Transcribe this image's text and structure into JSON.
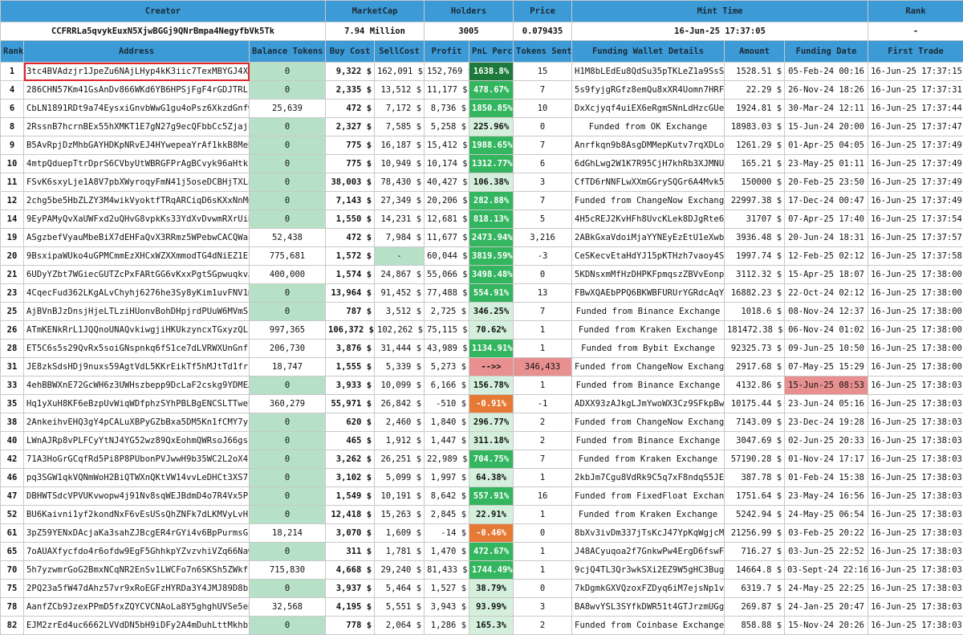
{
  "top_header": {
    "labels": [
      "Creator",
      "MarketCap",
      "Holders",
      "Price",
      "Mint Time",
      "Rank"
    ],
    "values": [
      "CCFRRLa5qvykEuxN5XjwBGGj9QNrBmpa4NegyfbVk5Tk",
      "7.94 Million",
      "3005",
      "0.079435",
      "16-Jun-25 17:37:05",
      "-"
    ]
  },
  "columns": [
    "Rank",
    "Address",
    "Balance Tokens",
    "Buy Cost",
    "SellCost",
    "Profit",
    "PnL Perc",
    "Tokens Sent",
    "Funding Wallet Details",
    "Amount",
    "Funding Date",
    "First Trade"
  ],
  "colors": {
    "header": "#3c9bd6",
    "balance_zero": "#b7e1c7",
    "pnl_dark": "#1e7a3c",
    "pnl_green": "#34b55f",
    "pnl_light": "#d4f0dc",
    "pnl_orange": "#e67a35",
    "alert_red": "#e89090",
    "highlight": "#e0252b"
  },
  "rows": [
    {
      "rank": "1",
      "address": "3tc4BVAdzjr1JpeZu6NAjLHyp4kK3iic7TexMBYGJ4Xk",
      "balance": "0",
      "buy": "9,322 $",
      "sell": "162,091 $",
      "profit": "152,769 $",
      "pnl": "1638.8%",
      "pnl_style": "dark",
      "sent": "15",
      "funding": "H1M8bLEdEu8QdSu35pTKLeZ1a9SsSn",
      "amount": "1528.51 $",
      "fdate": "05-Feb-24 00:16",
      "first": "16-Jun-25 17:37:15"
    },
    {
      "rank": "4",
      "address": "286CHN57Km41GsAnDv866WKd6YB6HPSjFgF4rGDJTRLf",
      "balance": "0",
      "buy": "2,335 $",
      "sell": "13,512 $",
      "profit": "11,177 $",
      "pnl": "478.67%",
      "pnl_style": "green",
      "sent": "7",
      "funding": "5s9fyjgRGfz8emQu8xXR4Uomn7HRFH",
      "amount": "22.29 $",
      "fdate": "26-Nov-24 18:26",
      "first": "16-Jun-25 17:37:31"
    },
    {
      "rank": "6",
      "address": "CbLN1891RDt9a74EysxiGnvbWwG1gu4oPsz6XkzdGnfw",
      "balance": "25,639",
      "buy": "472 $",
      "sell": "7,172 $",
      "profit": "8,736 $",
      "pnl": "1850.85%",
      "pnl_style": "green",
      "sent": "10",
      "funding": "DxXcjyqf4uiEX6eRgmSNnLdHzcGUeC",
      "amount": "1924.81 $",
      "fdate": "30-Mar-24 12:11",
      "first": "16-Jun-25 17:37:44"
    },
    {
      "rank": "8",
      "address": "2RssnB7hcrnBEx55hXMKT1E7gN27g9ecQFbbCc5Zjajq",
      "balance": "0",
      "buy": "2,327 $",
      "sell": "7,585 $",
      "profit": "5,258 $",
      "pnl": "225.96%",
      "pnl_style": "light",
      "sent": "0",
      "funding": "Funded from OK Exchange",
      "amount": "18983.03 $",
      "fdate": "15-Jun-24 20:00",
      "first": "16-Jun-25 17:37:47"
    },
    {
      "rank": "9",
      "address": "B5AvRpjDzMhbGAYHDKpNRvEJ4HYwepeaYrAf1kkB8MeR",
      "balance": "0",
      "buy": "775 $",
      "sell": "16,187 $",
      "profit": "15,412 $",
      "pnl": "1988.65%",
      "pnl_style": "green",
      "sent": "7",
      "funding": "Anrfkqn9b8AsgDMMepKutv7rqXDLoy",
      "amount": "1261.29 $",
      "fdate": "01-Apr-25 04:05",
      "first": "16-Jun-25 17:37:49"
    },
    {
      "rank": "10",
      "address": "4mtpQduepTtrDprS6CVbyUtWBRGFPrAgBCvyk96aHtkb",
      "balance": "0",
      "buy": "775 $",
      "sell": "10,949 $",
      "profit": "10,174 $",
      "pnl": "1312.77%",
      "pnl_style": "green",
      "sent": "6",
      "funding": "6dGhLwg2W1K7R95CjH7khRb3XJMNU6",
      "amount": "165.21 $",
      "fdate": "23-May-25 01:11",
      "first": "16-Jun-25 17:37:49"
    },
    {
      "rank": "11",
      "address": "FSvK6sxyLje1A8V7pbXWyroqyFmN41j5oseDCBHjTXL4",
      "balance": "0",
      "buy": "38,003 $",
      "sell": "78,430 $",
      "profit": "40,427 $",
      "pnl": "106.38%",
      "pnl_style": "light",
      "sent": "3",
      "funding": "CfTD6rNNFLwXXmGGrySQGr6A4Mvk5z",
      "amount": "150000 $",
      "fdate": "20-Feb-25 23:50",
      "first": "16-Jun-25 17:37:49"
    },
    {
      "rank": "12",
      "address": "2chg5be5HbZLZY3M4wikVyoktfTRqARCiqD6sKXxNnMm",
      "balance": "0",
      "buy": "7,143 $",
      "sell": "27,349 $",
      "profit": "20,206 $",
      "pnl": "282.88%",
      "pnl_style": "green",
      "sent": "7",
      "funding": "Funded from ChangeNow Exchange",
      "amount": "22997.38 $",
      "fdate": "17-Dec-24 00:47",
      "first": "16-Jun-25 17:37:49"
    },
    {
      "rank": "14",
      "address": "9EyPAMyQvXaUWFxd2uQHvG8vpkKs33YdXvDvwmRXrUiH",
      "balance": "0",
      "buy": "1,550 $",
      "sell": "14,231 $",
      "profit": "12,681 $",
      "pnl": "818.13%",
      "pnl_style": "green",
      "sent": "5",
      "funding": "4H5cREJ2KvHFh8UvcKLek8DJgRte6k",
      "amount": "31707 $",
      "fdate": "07-Apr-25 17:40",
      "first": "16-Jun-25 17:37:54"
    },
    {
      "rank": "19",
      "address": "ASgzbefVyauMbeBiX7dEHFaQvX3RRmz5WPebwCACQWaq",
      "balance": "52,438",
      "buy": "472 $",
      "sell": "7,984 $",
      "profit": "11,677 $",
      "pnl": "2473.94%",
      "pnl_style": "green",
      "sent": "3,216",
      "funding": "2ABkGxaVdoiMjaYYNEyEzEtU1eXwbx",
      "amount": "3936.48 $",
      "fdate": "20-Jun-24 18:31",
      "first": "16-Jun-25 17:37:57"
    },
    {
      "rank": "20",
      "address": "9BsxipaWUko4uGPMCmmEzXHCxWZXXmmodTG4dNiEZ1Et",
      "balance": "775,681",
      "buy": "1,572 $",
      "sell": "-",
      "profit": "60,044 $",
      "pnl": "3819.59%",
      "pnl_style": "green",
      "sent": "-3",
      "funding": "CeSKecvEtaHdYJ15pKTHzh7vaoy4SY",
      "amount": "1997.74 $",
      "fdate": "12-Feb-25 02:12",
      "first": "16-Jun-25 17:37:58"
    },
    {
      "rank": "21",
      "address": "6UDyYZbt7WGiecGUTZcPxFARtGG6vKxxPgtSGpwuqkvA",
      "balance": "400,000",
      "buy": "1,574 $",
      "sell": "24,867 $",
      "profit": "55,066 $",
      "pnl": "3498.48%",
      "pnl_style": "green",
      "sent": "0",
      "funding": "5KDNsxmMfHzDHPKFpmqszZBVvEonp",
      "amount": "3112.32 $",
      "fdate": "15-Apr-25 18:07",
      "first": "16-Jun-25 17:38:00"
    },
    {
      "rank": "23",
      "address": "4CqecFud362LKgALvChyhj6276he3Sy8yKim1uvFNV1m",
      "balance": "0",
      "buy": "13,964 $",
      "sell": "91,452 $",
      "profit": "77,488 $",
      "pnl": "554.91%",
      "pnl_style": "green",
      "sent": "13",
      "funding": "FBwXQAEbPPQ6BKWBFURUrYGRdcAqYT",
      "amount": "16882.23 $",
      "fdate": "22-Oct-24 02:12",
      "first": "16-Jun-25 17:38:00"
    },
    {
      "rank": "25",
      "address": "AjBVnBJzDnsjHjeLTLziHUonvBohDHpjrdPUuW6MVmS2",
      "balance": "0",
      "buy": "787 $",
      "sell": "3,512 $",
      "profit": "2,725 $",
      "pnl": "346.25%",
      "pnl_style": "light",
      "sent": "7",
      "funding": "Funded from Binance Exchange",
      "amount": "1018.6 $",
      "fdate": "08-Nov-24 12:37",
      "first": "16-Jun-25 17:38:00"
    },
    {
      "rank": "26",
      "address": "ATmKENkRrL1JQQnoUNAQvkiwgjiHKUkzyncxTGxyzQL1",
      "balance": "997,365",
      "buy": "106,372 $",
      "sell": "102,262 $",
      "profit": "75,115 $",
      "pnl": "70.62%",
      "pnl_style": "light",
      "sent": "1",
      "funding": "Funded from Kraken Exchange",
      "amount": "181472.38 $",
      "fdate": "06-Nov-24 01:02",
      "first": "16-Jun-25 17:38:00"
    },
    {
      "rank": "28",
      "address": "ET5C6s5s29QvRx5soiGNspnkq6fS1ce7dLVRWXUnGnf",
      "balance": "206,730",
      "buy": "3,876 $",
      "sell": "31,444 $",
      "profit": "43,989 $",
      "pnl": "1134.91%",
      "pnl_style": "green",
      "sent": "1",
      "funding": "Funded from Bybit Exchange",
      "amount": "92325.73 $",
      "fdate": "09-Jun-25 10:50",
      "first": "16-Jun-25 17:38:00"
    },
    {
      "rank": "31",
      "address": "JE8zkSdsHDj9nuxs59AgtVdL5KKrEikTf5hMJtTd1frP",
      "balance": "18,747",
      "buy": "1,555 $",
      "sell": "5,339 $",
      "profit": "5,273 $",
      "pnl": "-->>",
      "pnl_style": "red",
      "sent": "346,433",
      "funding": "Funded from ChangeNow Exchange",
      "amount": "2917.68 $",
      "fdate": "07-May-25 15:29",
      "first": "16-Jun-25 17:38:00"
    },
    {
      "rank": "33",
      "address": "4ehBBWXnE72GcWH6z3UWHszbepp9DcLaF2cskg9YDMEA",
      "balance": "0",
      "buy": "3,933 $",
      "sell": "10,099 $",
      "profit": "6,166 $",
      "pnl": "156.78%",
      "pnl_style": "light",
      "sent": "1",
      "funding": "Funded from Binance Exchange",
      "amount": "4132.86 $",
      "fdate": "15-Jun-25 08:53",
      "first": "16-Jun-25 17:38:03"
    },
    {
      "rank": "35",
      "address": "Hq1yXuH8KF6eBzpUvWiqWDfphzSYhPBLBgENCSLTTweU",
      "balance": "360,279",
      "buy": "55,971 $",
      "sell": "26,842 $",
      "profit": "-510 $",
      "pnl": "-0.91%",
      "pnl_style": "orange",
      "sent": "-1",
      "funding": "ADXX93zAJkgLJmYwoWX3Cz9SFkpBwW",
      "amount": "10175.44 $",
      "fdate": "23-Jun-24 05:16",
      "first": "16-Jun-25 17:38:03"
    },
    {
      "rank": "38",
      "address": "2AnkeihvEHQ3gY4pCALuXBPyGZbBxa5DM5Kn1fCMY7yh",
      "balance": "0",
      "buy": "620 $",
      "sell": "2,460 $",
      "profit": "1,840 $",
      "pnl": "296.77%",
      "pnl_style": "light",
      "sent": "2",
      "funding": "Funded from ChangeNow Exchange",
      "amount": "7143.09 $",
      "fdate": "23-Dec-24 19:28",
      "first": "16-Jun-25 17:38:03"
    },
    {
      "rank": "40",
      "address": "LWnAJRp8vPLFCyYtNJ4YG52wz89QxEohmQWRsoJ66gs",
      "balance": "0",
      "buy": "465 $",
      "sell": "1,912 $",
      "profit": "1,447 $",
      "pnl": "311.18%",
      "pnl_style": "light",
      "sent": "2",
      "funding": "Funded from Binance Exchange",
      "amount": "3047.69 $",
      "fdate": "02-Jun-25 20:33",
      "first": "16-Jun-25 17:38:03"
    },
    {
      "rank": "42",
      "address": "71A3HoGrGCqfRd5Pi8P8PUbonPVJwwH9b35WC2L2oX4i",
      "balance": "0",
      "buy": "3,262 $",
      "sell": "26,251 $",
      "profit": "22,989 $",
      "pnl": "704.75%",
      "pnl_style": "green",
      "sent": "7",
      "funding": "Funded from Kraken Exchange",
      "amount": "57190.28 $",
      "fdate": "01-Nov-24 17:17",
      "first": "16-Jun-25 17:38:03"
    },
    {
      "rank": "46",
      "address": "pq3SGW1qkVQNmWoH2BiQTWXnQKtVW14vvLeDHCt3XS7",
      "balance": "0",
      "buy": "3,102 $",
      "sell": "5,099 $",
      "profit": "1,997 $",
      "pnl": "64.38%",
      "pnl_style": "light",
      "sent": "1",
      "funding": "2kbJm7Cgu8VdRk9C5q7xF8ndqS5JEy",
      "amount": "387.78 $",
      "fdate": "01-Feb-24 15:38",
      "first": "16-Jun-25 17:38:03"
    },
    {
      "rank": "47",
      "address": "DBHWTSdcVPVUKvwopw4j91Nv8sqWEJBdmD4o7R4Vx5Pi",
      "balance": "0",
      "buy": "1,549 $",
      "sell": "10,191 $",
      "profit": "8,642 $",
      "pnl": "557.91%",
      "pnl_style": "green",
      "sent": "16",
      "funding": "Funded from FixedFloat Exchang",
      "amount": "1751.64 $",
      "fdate": "23-May-24 16:56",
      "first": "16-Jun-25 17:38:03"
    },
    {
      "rank": "52",
      "address": "BU6Kaivni1yf2kondNxF6vEsUSsQhZNFk7dLKMVyLvHz",
      "balance": "0",
      "buy": "12,418 $",
      "sell": "15,263 $",
      "profit": "2,845 $",
      "pnl": "22.91%",
      "pnl_style": "light",
      "sent": "1",
      "funding": "Funded from Kraken Exchange",
      "amount": "5242.94 $",
      "fdate": "24-May-25 06:54",
      "first": "16-Jun-25 17:38:03"
    },
    {
      "rank": "61",
      "address": "3pZ59YENxDAcjaKa3sahZJBcgER4rGYi4v6BpPurmsGj",
      "balance": "18,214",
      "buy": "3,070 $",
      "sell": "1,609 $",
      "profit": "-14 $",
      "pnl": "-0.46%",
      "pnl_style": "orange",
      "sent": "0",
      "funding": "8bXv3ivDm337jTsKcJ47YpKqWgjcM4",
      "amount": "21256.99 $",
      "fdate": "03-Feb-25 20:22",
      "first": "16-Jun-25 17:38:03"
    },
    {
      "rank": "65",
      "address": "7oAUAXfycfdo4r6ofdw9EgF5GhhkpYZvzvhiVZq66Naw",
      "balance": "0",
      "buy": "311 $",
      "sell": "1,781 $",
      "profit": "1,470 $",
      "pnl": "472.67%",
      "pnl_style": "green",
      "sent": "1",
      "funding": "J48ACyuqoa2f7GnkwPw4ErgD6fswFG",
      "amount": "716.27 $",
      "fdate": "03-Jun-25 22:52",
      "first": "16-Jun-25 17:38:03"
    },
    {
      "rank": "70",
      "address": "5h7yzwmrGoG2BmxNCqNR2EnSv1LWCFo7n6SKSh5ZWkfE",
      "balance": "715,830",
      "buy": "4,668 $",
      "sell": "29,240 $",
      "profit": "81,433 $",
      "pnl": "1744.49%",
      "pnl_style": "green",
      "sent": "1",
      "funding": "9cjQ4TL3Qr3wkSXi2EZ9W5gHC3Bugj",
      "amount": "14664.8 $",
      "fdate": "03-Sept-24 22:16",
      "first": "16-Jun-25 17:38:03"
    },
    {
      "rank": "75",
      "address": "2PQ23a5fW47dAhz57vr9xRoEGFzHYRDa3Y4JMJ89D8b3",
      "balance": "0",
      "buy": "3,937 $",
      "sell": "5,464 $",
      "profit": "1,527 $",
      "pnl": "38.79%",
      "pnl_style": "light",
      "sent": "0",
      "funding": "7kDgmkGXVQzoxFZDyq6iM7ejsNp1vt",
      "amount": "6319.7 $",
      "fdate": "24-May-25 22:25",
      "first": "16-Jun-25 17:38:03"
    },
    {
      "rank": "78",
      "address": "AanfZCb9JzexPPmD5fxZQYCVCNAoLa8Y5ghghUVSe5eN",
      "balance": "32,568",
      "buy": "4,195 $",
      "sell": "5,551 $",
      "profit": "3,943 $",
      "pnl": "93.99%",
      "pnl_style": "light",
      "sent": "3",
      "funding": "BA8wvYSL3SYfkDWR51t4GTJrzmUGg",
      "amount": "269.87 $",
      "fdate": "24-Jan-25 20:47",
      "first": "16-Jun-25 17:38:03"
    },
    {
      "rank": "82",
      "address": "EJM2zrEd4uc6662LVVdDN5bH9iDFy2A4mDuhLttMkhby",
      "balance": "0",
      "buy": "778 $",
      "sell": "2,064 $",
      "profit": "1,286 $",
      "pnl": "165.3%",
      "pnl_style": "light",
      "sent": "2",
      "funding": "Funded from Coinbase Exchange",
      "amount": "858.88 $",
      "fdate": "15-Nov-24 20:26",
      "first": "16-Jun-25 17:38:03"
    }
  ]
}
